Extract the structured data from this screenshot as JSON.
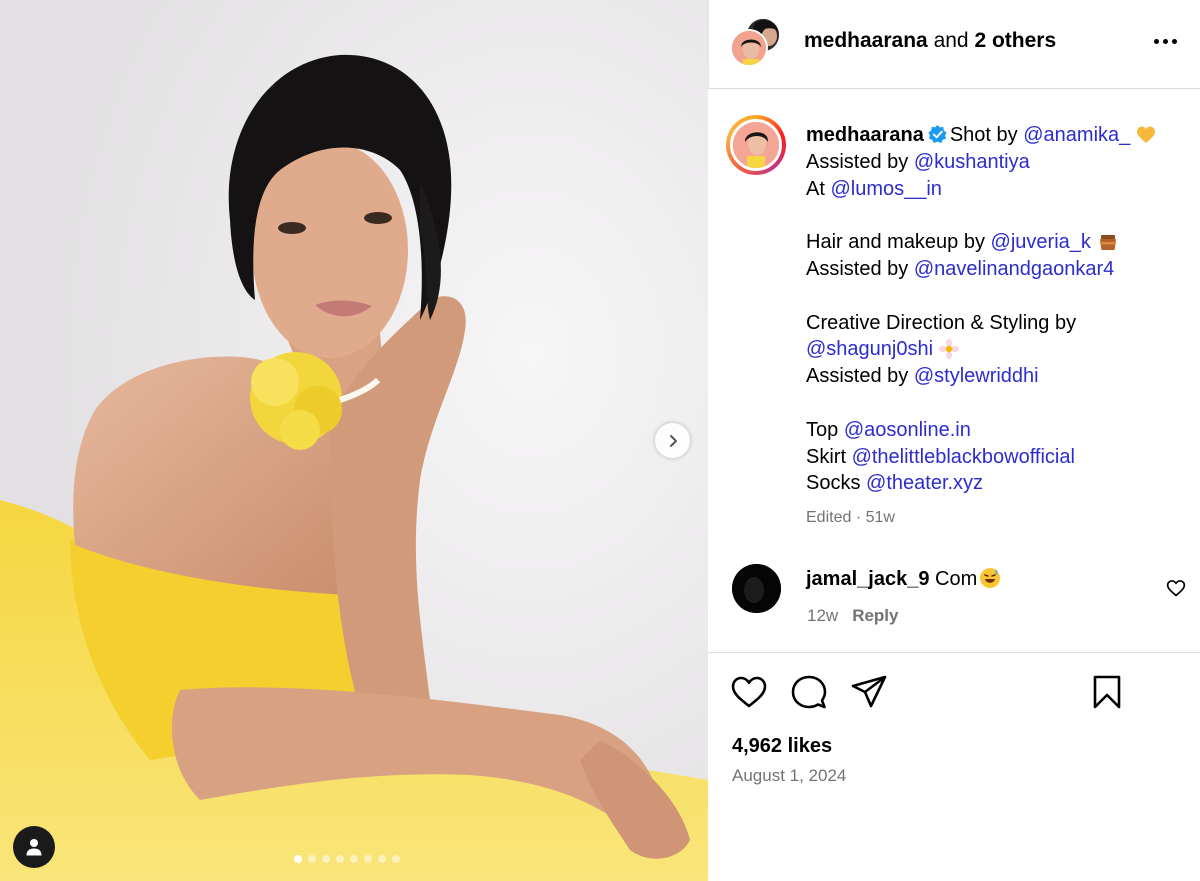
{
  "header": {
    "username": "medhaarana",
    "and_text": "and",
    "others_text": "2 others"
  },
  "caption": {
    "username": "medhaarana",
    "lines": [
      {
        "text": "Shot by ",
        "mention": "@anamika_",
        "emoji": "yellow-heart"
      },
      {
        "text": "Assisted by ",
        "mention": "@kushantiya"
      },
      {
        "text": "At ",
        "mention": "@lumos__in"
      },
      {
        "text": "Hair and makeup by ",
        "mention": "@juveria_k",
        "emoji": "honey-pot"
      },
      {
        "text": "Assisted by ",
        "mention": "@navelinandgaonkar4"
      },
      {
        "text": "Creative Direction & Styling by"
      },
      {
        "mention": "@shagunj0shi",
        "emoji": "daisy-flower"
      },
      {
        "text": "Assisted by ",
        "mention": "@stylewriddhi"
      },
      {
        "text": "Top ",
        "mention": "@aosonline.in"
      },
      {
        "text": "Skirt ",
        "mention": "@thelittleblackbowofficial"
      },
      {
        "text": "Socks ",
        "mention": "@theater.xyz"
      }
    ],
    "meta": "Edited · 51w"
  },
  "comment": {
    "username": "jamal_jack_9",
    "text": "Com",
    "emoji": "smiling-face-with-sweat",
    "age": "12w",
    "reply_label": "Reply"
  },
  "likes": "4,962 likes",
  "date": "August 1, 2024",
  "carousel": {
    "slide_count": 8,
    "active_index": 0
  },
  "colors": {
    "mention": "#2c2cd0",
    "muted": "#737373",
    "verified": "#1d9bf0",
    "divider": "#dbdbdb"
  }
}
